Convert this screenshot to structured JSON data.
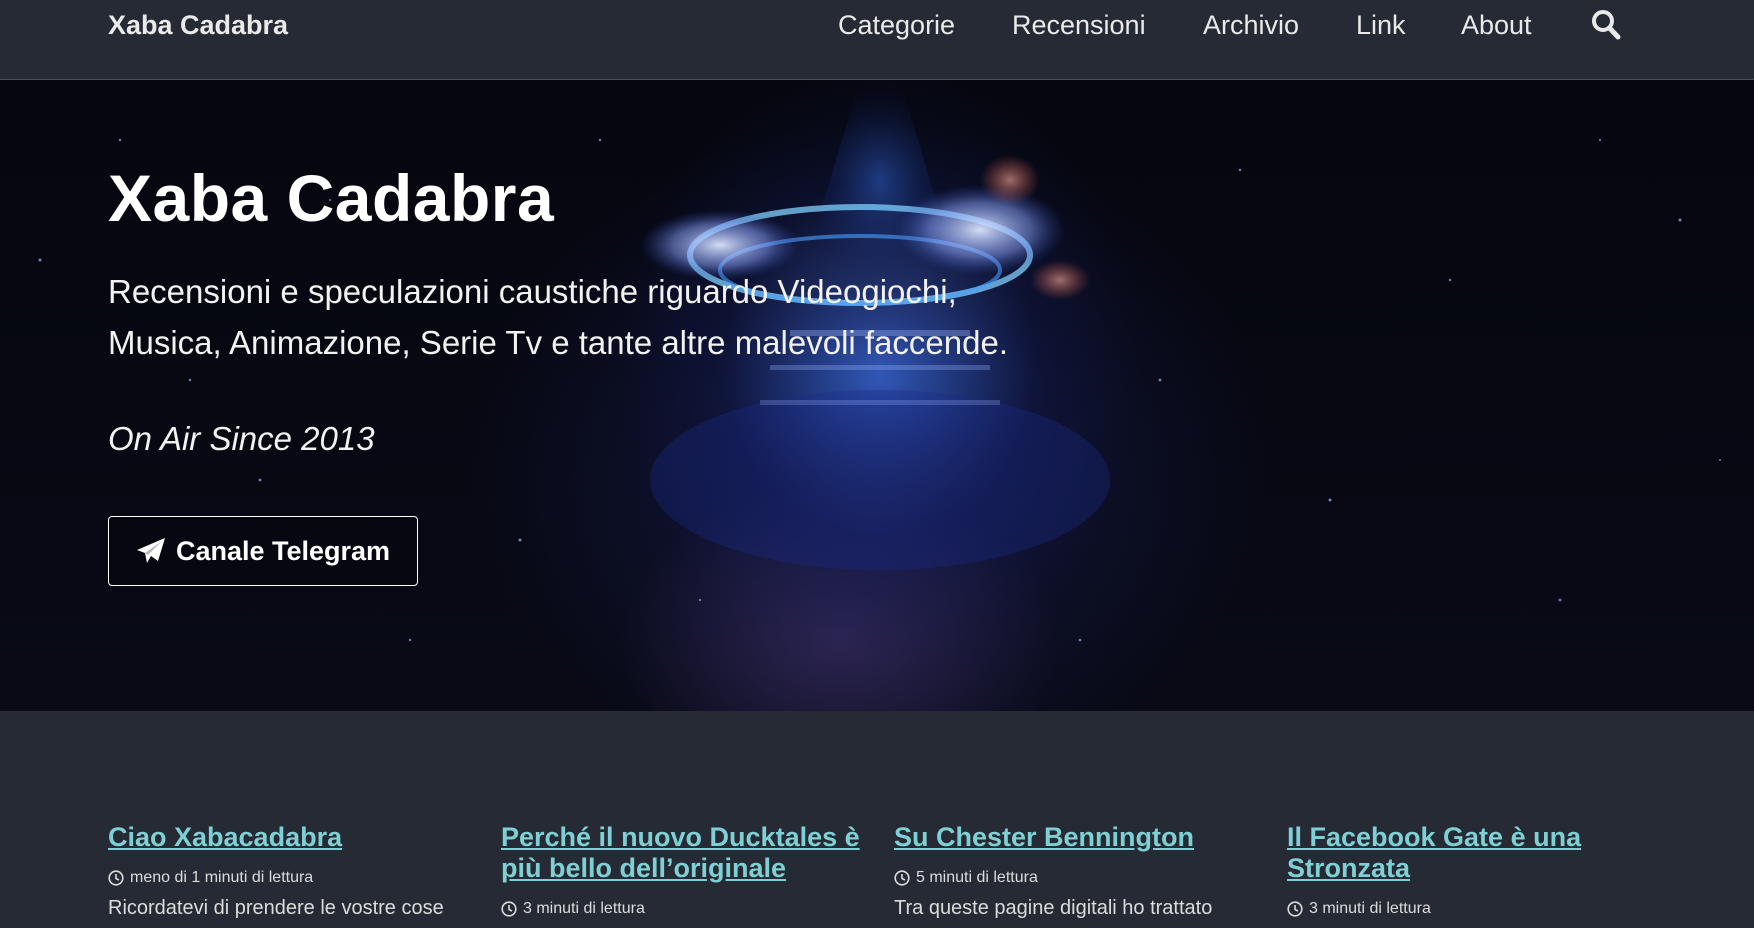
{
  "masthead": {
    "site_title": "Xaba Cadabra",
    "nav": [
      {
        "label": "Categorie"
      },
      {
        "label": "Recensioni"
      },
      {
        "label": "Archivio"
      },
      {
        "label": "Link"
      },
      {
        "label": "About"
      }
    ],
    "search_icon": "search-icon"
  },
  "hero": {
    "title": "Xaba Cadabra",
    "excerpt_line1": "Recensioni e speculazioni caustiche riguardo Videogiochi,",
    "excerpt_line2": "Musica, Animazione, Serie Tv e tante altre malevoli faccende.",
    "tagline": "On Air Since 2013",
    "cta_label": "Canale Telegram",
    "cta_icon": "paper-plane-icon"
  },
  "posts": [
    {
      "title": "Ciao Xabacadabra",
      "meta": "meno di 1 minuti di lettura",
      "excerpt": "Ricordatevi di prendere le vostre cose"
    },
    {
      "title": "Perché il nuovo Ducktales è più bello dell’originale",
      "meta": "3 minuti di lettura",
      "excerpt": ""
    },
    {
      "title": "Su Chester Bennington",
      "meta": "5 minuti di lettura",
      "excerpt": "Tra queste pagine digitali ho trattato"
    },
    {
      "title": "Il Facebook Gate è una Stronzata",
      "meta": "3 minuti di lettura",
      "excerpt": ""
    }
  ],
  "colors": {
    "background": "#252a34",
    "link": "#7ed0d4",
    "text": "#eaeaea"
  }
}
